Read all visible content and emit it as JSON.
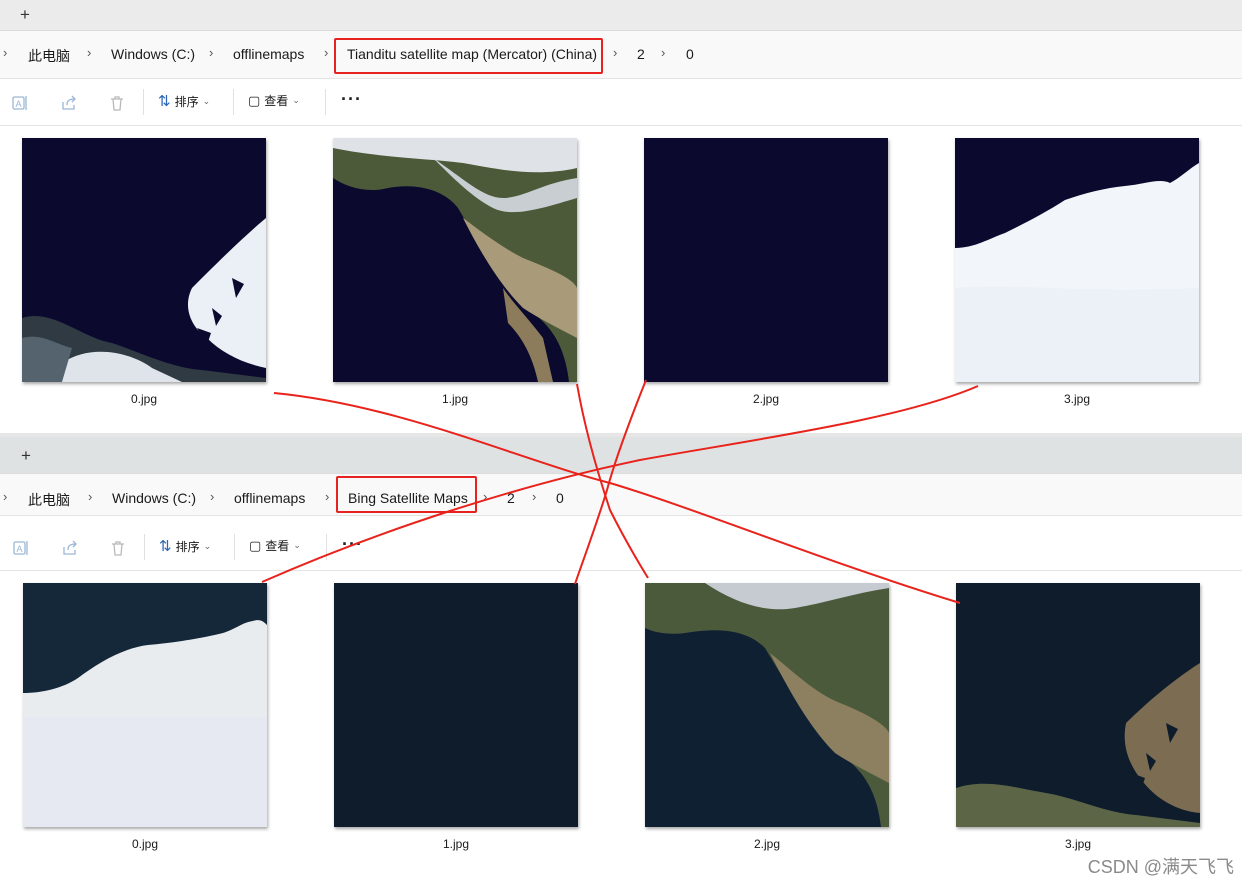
{
  "top_window": {
    "tab_add": "+",
    "breadcrumb": [
      "此电脑",
      "Windows (C:)",
      "offlinemaps",
      "Tianditu satellite map (Mercator) (China)",
      "2",
      "0"
    ],
    "breadcrumb_leading": "›",
    "toolbar": {
      "sort_label": "排序",
      "view_label": "查看",
      "more": "···"
    },
    "files": [
      "0.jpg",
      "1.jpg",
      "2.jpg",
      "3.jpg"
    ]
  },
  "bottom_window": {
    "tab_add": "+",
    "breadcrumb": [
      "此电脑",
      "Windows (C:)",
      "offlinemaps",
      "Bing Satellite Maps",
      "2",
      "0"
    ],
    "breadcrumb_leading": "›",
    "toolbar": {
      "sort_label": "排序",
      "view_label": "查看",
      "more": "···"
    },
    "files": [
      "0.jpg",
      "1.jpg",
      "2.jpg",
      "3.jpg"
    ]
  },
  "watermark": "CSDN @满天飞飞",
  "colors": {
    "highlight": "#e6231f",
    "annotation_line": "#e8231c",
    "ocean_tianditu": "#0b0a2e",
    "ocean_bing": "#0d1b2b"
  },
  "icons": [
    "rename-icon",
    "share-icon",
    "delete-icon",
    "sort-icon",
    "view-icon",
    "more-icon",
    "chevron-right-icon",
    "chevron-down-icon"
  ]
}
